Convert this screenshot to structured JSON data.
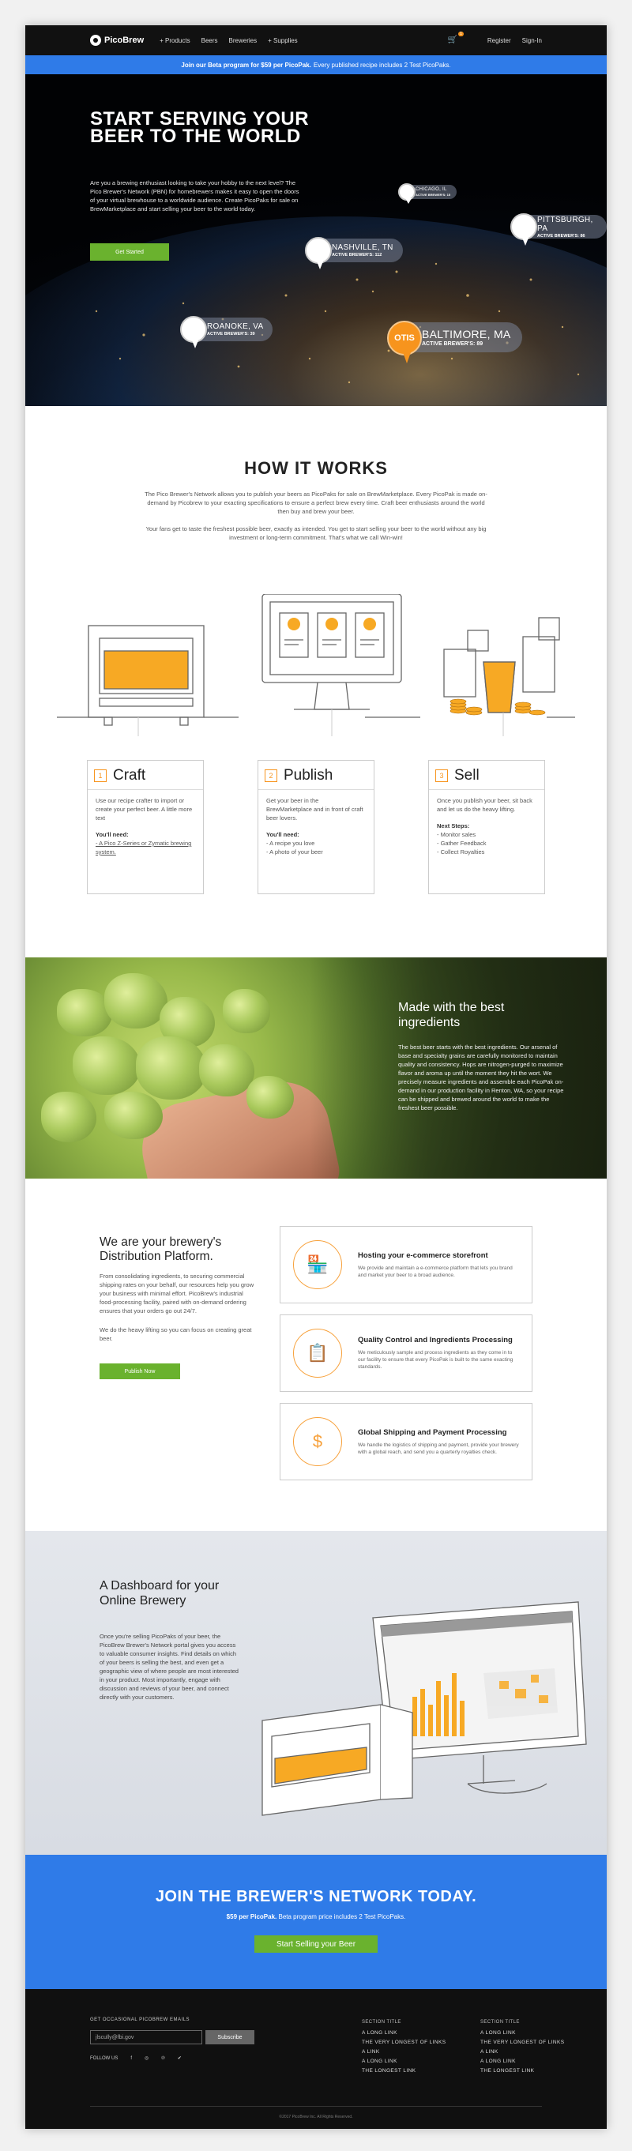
{
  "nav": {
    "brand": "PicoBrew",
    "menu": [
      "+ Products",
      "Beers",
      "Breweries",
      "+ Supplies"
    ],
    "cart_count": "1",
    "register": "Register",
    "signin": "Sign-In"
  },
  "beta": {
    "bold": "Join our Beta program for $59 per PicoPak.",
    "rest": "Every published recipe includes 2 Test PicoPaks."
  },
  "hero": {
    "title": "START SERVING YOUR BEER TO THE WORLD",
    "text": "Are you a brewing enthusiast looking to take your hobby to the next level? The Pico Brewer's Network (PBN) for homebrewers makes it easy to open the doors of your virtual brewhouse to a worldwide audience. Create PicoPaks for sale on BrewMarketplace and start selling your beer to the world today.",
    "cta": "Get Started",
    "pins": [
      {
        "city": "NASHVILLE, TN",
        "count": "ACTIVE BREWER'S: 112"
      },
      {
        "city": "PITTSBURGH, PA",
        "count": "ACTIVE BREWER'S: 86"
      },
      {
        "city": "ROANOKE, VA",
        "count": "ACTIVE BREWER'S: 39"
      },
      {
        "city": "BALTIMORE, MA",
        "count": "ACTIVE BREWER'S: 89"
      },
      {
        "city": "CHICAGO, IL",
        "count": "ACTIVE BREWER'S: 15"
      }
    ],
    "badge_text": "OTIS"
  },
  "how": {
    "title": "HOW IT WORKS",
    "p1": "The Pico Brewer's Network allows you to publish your beers as PicoPaks for sale on BrewMarketplace. Every PicoPak is made on-demand by Picobrew to your exacting specifications to ensure a perfect brew every time. Craft beer enthusiasts around the world then buy and brew your beer.",
    "p2": "Your fans get to taste the freshest possible beer, exactly as intended. You get to start selling your beer to the world without any big investment or long-term commitment. That's what we call Win-win!",
    "cards": [
      {
        "num": "1",
        "title": "Craft",
        "desc": "Use our recipe crafter to import or create your perfect beer. A little more text",
        "need_label": "You'll need:",
        "items": [
          "- A Pico Z-Series or Zymatic brewing system."
        ]
      },
      {
        "num": "2",
        "title": "Publish",
        "desc": "Get your beer in the BrewMarketplace and in front of craft beer lovers.",
        "need_label": "You'll need:",
        "items": [
          "- A recipe you love",
          "- A photo of your beer"
        ]
      },
      {
        "num": "3",
        "title": "Sell",
        "desc": "Once you publish your beer, sit back and let us do the heavy lifting.",
        "need_label": "Next Steps:",
        "items": [
          "- Monitor sales",
          "- Gather Feedback",
          "- Collect Royalties"
        ]
      }
    ]
  },
  "ingredients": {
    "title": "Made with the best ingredients",
    "text": "The best beer starts with the best ingredients. Our arsenal of base and specialty grains are carefully monitored to maintain quality and consistency. Hops are nitrogen-purged to maximize flavor and aroma up until the moment they hit the wort. We precisely measure ingredients and assemble each PicoPak on-demand in our production facility in Renton, WA, so your recipe can be shipped and brewed around the world to make the freshest beer possible."
  },
  "distribution": {
    "title": "We are your brewery's Distribution Platform.",
    "p1": "From consolidating ingredients, to securing commercial shipping rates on your behalf, our resources help you grow your business with minimal effort. PicoBrew's industrial food-processing facility, paired with on-demand ordering ensures that your orders go out 24/7.",
    "p2": "We do the heavy lifting so you can focus on creating great beer.",
    "cta": "Publish Now",
    "features": [
      {
        "title": "Hosting your e-commerce storefront",
        "text": "We provide and maintain a e-commerce platform that lets you brand and market your beer to a broad audience.",
        "icon": "storefront-icon"
      },
      {
        "title": "Quality Control and Ingredients Processing",
        "text": "We meticulously sample and process ingredients as they come in to our facility to ensure that every PicoPak is built to the same exacting standards.",
        "icon": "clipboard-icon"
      },
      {
        "title": "Global Shipping and Payment Processing",
        "text": "We handle the logistics of shipping and payment, provide your brewery with a global reach, and send you a quarterly royalties check.",
        "icon": "dollar-coin-icon"
      }
    ]
  },
  "dashboard": {
    "title": "A Dashboard for your Online Brewery",
    "text": "Once you're selling PicoPaks of your beer, the PicoBrew Brewer's Network portal gives you access to valuable consumer insights. Find details on which of your beers is selling the best, and even get a geographic view of where people are most interested in your product. Most importantly, engage with discussion and reviews of your beer, and connect directly with your customers."
  },
  "join": {
    "title": "JOIN THE BREWER'S NETWORK TODAY.",
    "sub_bold": "$59 per PicoPak.",
    "sub_rest": "Beta program price includes 2 Test PicoPaks.",
    "cta": "Start Selling your Beer"
  },
  "footer": {
    "emails_label": "GET OCCASIONAL PICOBREW EMAILS",
    "email_value": "jlscully@fbi.gov",
    "subscribe": "Subscribe",
    "follow": "FOLLOW US",
    "social": [
      "f",
      "◎",
      "℗",
      "✔"
    ],
    "col1": {
      "title": "SECTION TITLE",
      "links": [
        "A LONG LINK",
        "THE VERY LONGEST OF LINKS",
        "A LINK",
        "A LONG LINK",
        "THE LONGEST LINK"
      ]
    },
    "col2": {
      "title": "SECTION TITLE",
      "links": [
        "A LONG LINK",
        "THE VERY LONGEST OF LINKS",
        "A LINK",
        "A LONG LINK",
        "THE LONGEST LINK"
      ]
    },
    "copyright": "©2017 PicoBrew Inc. All Rights Reserved."
  },
  "colors": {
    "accent_blue": "#2f7be8",
    "accent_green": "#6ab22e",
    "accent_orange": "#f7941d"
  }
}
